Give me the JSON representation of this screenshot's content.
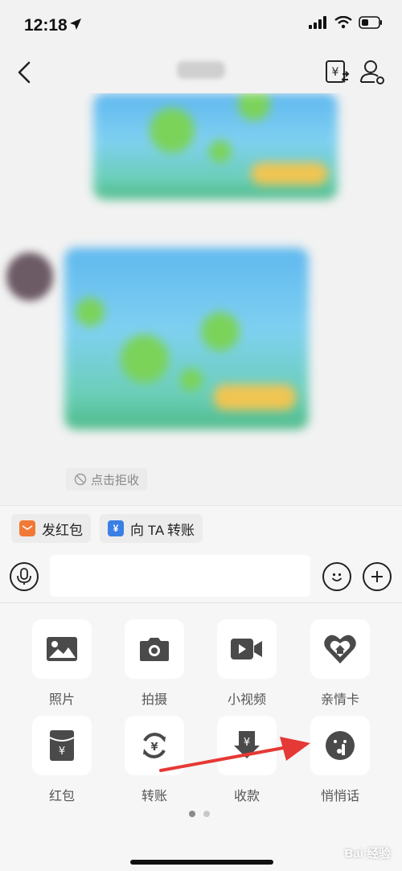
{
  "status_bar": {
    "time": "12:18"
  },
  "chat": {
    "refuse_label": "点击拒收"
  },
  "quick_actions": [
    {
      "label": "发红包",
      "icon": "red-packet-icon",
      "color": "#f27935",
      "glyph": "◒"
    },
    {
      "label": "向 TA 转账",
      "icon": "transfer-icon",
      "color": "#3a7fe4",
      "glyph": "¥"
    }
  ],
  "panel": {
    "items": [
      {
        "label": "照片",
        "icon": "photo-icon"
      },
      {
        "label": "拍摄",
        "icon": "camera-icon"
      },
      {
        "label": "小视频",
        "icon": "video-icon"
      },
      {
        "label": "亲情卡",
        "icon": "family-card-icon"
      },
      {
        "label": "红包",
        "icon": "red-packet-icon"
      },
      {
        "label": "转账",
        "icon": "transfer-icon"
      },
      {
        "label": "收款",
        "icon": "receive-money-icon"
      },
      {
        "label": "悄悄话",
        "icon": "whisper-icon"
      }
    ],
    "page_count": 2,
    "current_page": 1
  },
  "colors": {
    "icon_gray": "#4a4a4a",
    "arrow_red": "#e53935"
  }
}
